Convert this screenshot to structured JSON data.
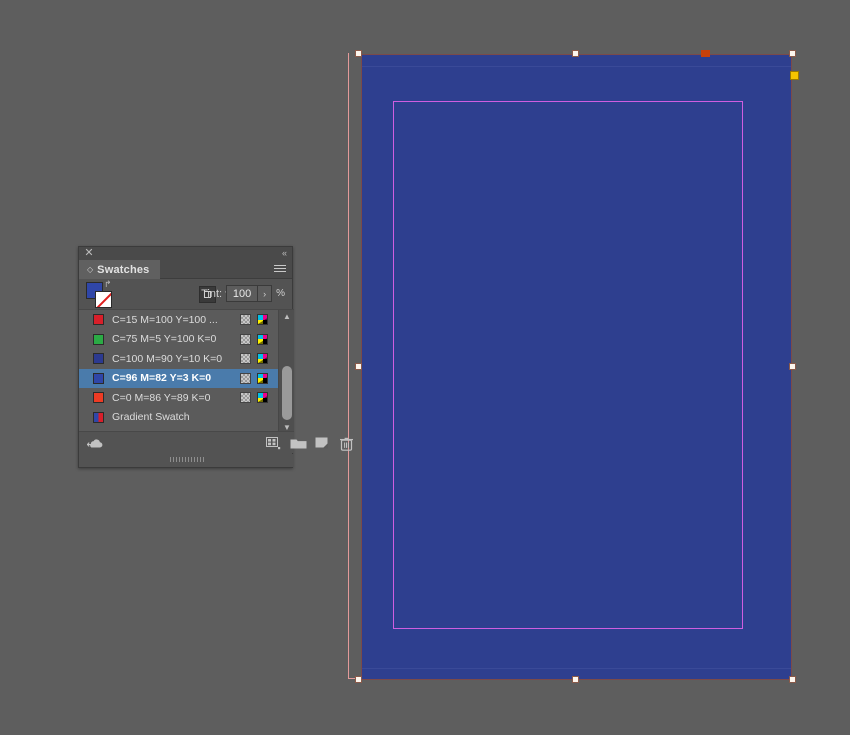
{
  "app": {
    "background_color": "#5e5e5e"
  },
  "canvas": {
    "document": {
      "fill_color": "#2e3f8f",
      "page_edge_color": "#e39a9a",
      "margin_guide_color": "#cf5ee0",
      "selection_handle_color": "#fdf6ee",
      "anchor_yellow_color": "#f5c400",
      "marker_orange_color": "#c8410b"
    }
  },
  "panel": {
    "close_label": "✕",
    "collapse_label": "«",
    "tab": {
      "label": "Swatches",
      "diamond": "◇"
    },
    "menu_name": "panel-menu-icon",
    "tools": {
      "fill_color": "#2f46a8",
      "stroke_label": "none",
      "swap_label": "↱",
      "format_container_label": "□",
      "format_text_label": "T",
      "tint_label": "Tint:",
      "tint_value": "100",
      "tint_placeholder": "100",
      "tint_arrow": "›",
      "tint_percent": "%"
    },
    "swatches": [
      {
        "label": "C=15 M=100 Y=100 ...",
        "color": "#d81f2a",
        "type": "process",
        "selected": false
      },
      {
        "label": "C=75 M=5 Y=100 K=0",
        "color": "#2bab45",
        "type": "process",
        "selected": false
      },
      {
        "label": "C=100 M=90 Y=10 K=0",
        "color": "#2c3a90",
        "type": "process",
        "selected": false
      },
      {
        "label": "C=96 M=82 Y=3 K=0",
        "color": "#2f46a8",
        "type": "process",
        "selected": true
      },
      {
        "label": "C=0 M=86 Y=89 K=0",
        "color": "#ee3b24",
        "type": "process",
        "selected": false
      },
      {
        "label": "Gradient Swatch",
        "color": "gradient",
        "type": "gradient",
        "selected": false
      }
    ],
    "scrollbar": {
      "up_arrow": "▲",
      "down_arrow": "▼"
    },
    "bottom_buttons": [
      {
        "name": "cc-libraries-icon",
        "title": "Add to CC Library"
      },
      {
        "name": "new-color-group-icon",
        "title": "New Color Group"
      },
      {
        "name": "new-swatch-folder-icon",
        "title": "New Color Group Folder"
      },
      {
        "name": "new-swatch-icon",
        "title": "New Swatch"
      },
      {
        "name": "delete-swatch-icon",
        "title": "Delete Swatch"
      }
    ]
  }
}
